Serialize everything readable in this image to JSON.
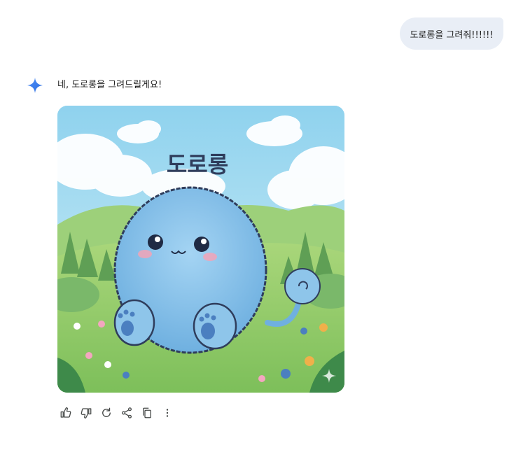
{
  "conversation": {
    "user_message": "도로롱을 그려줘!!!!!!",
    "assistant_reply": "네, 도로롱을 그려드릴게요!",
    "image_title_text": "도로롱"
  },
  "icons": {
    "assistant_avatar": "gemini-sparkle-icon",
    "actions": [
      "thumbs-up-icon",
      "thumbs-down-icon",
      "regenerate-icon",
      "share-icon",
      "copy-icon",
      "more-vert-icon"
    ]
  },
  "colors": {
    "user_bubble": "#e9eef6",
    "sparkle_blue": "#4285f4",
    "creature_blue": "#8ec5ea"
  }
}
